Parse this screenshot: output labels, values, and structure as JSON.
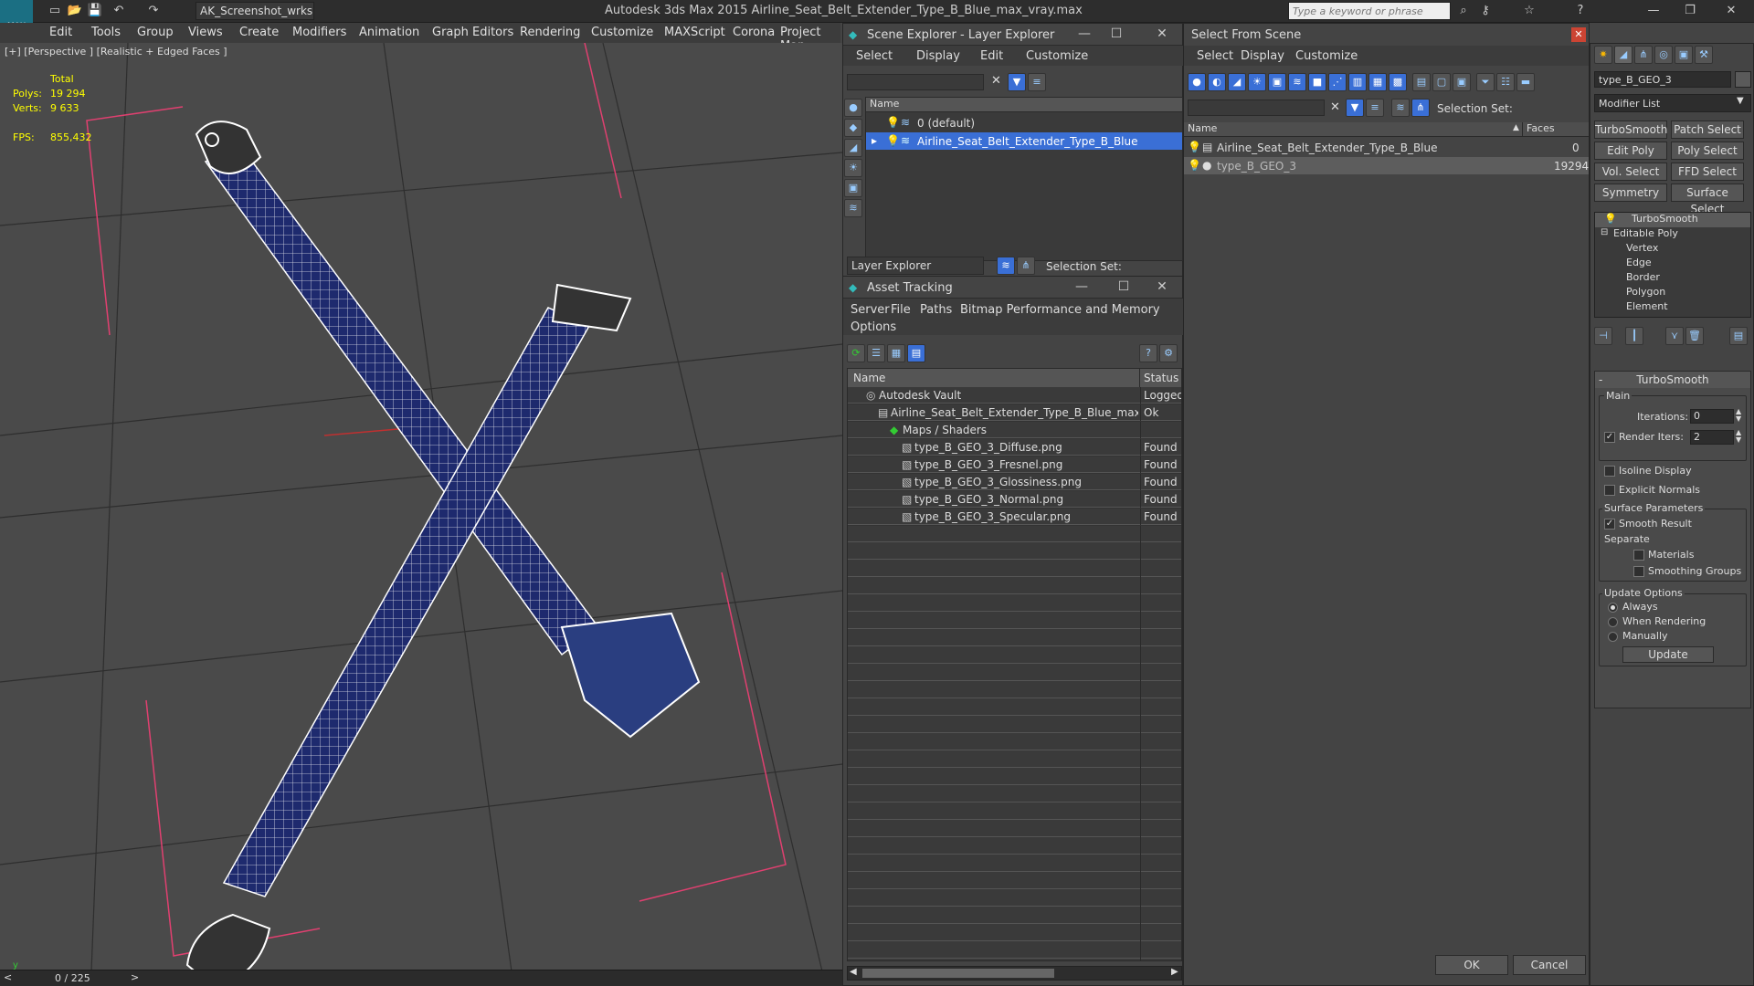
{
  "app": {
    "logo": "MAX",
    "title": "Autodesk 3ds Max  2015    Airline_Seat_Belt_Extender_Type_B_Blue_max_vray.max",
    "workspace": "AK_Screenshot_wrksp",
    "search_placeholder": "Type a keyword or phrase"
  },
  "menu": [
    "Edit",
    "Tools",
    "Group",
    "Views",
    "Create",
    "Modifiers",
    "Animation",
    "Graph Editors",
    "Rendering",
    "Customize",
    "MAXScript",
    "Corona",
    "Project Man"
  ],
  "viewport": {
    "label": "[+] [Perspective ] [Realistic + Edged Faces ]",
    "stats": {
      "total_label": "Total",
      "polys_label": "Polys:",
      "polys": "19 294",
      "verts_label": "Verts:",
      "verts": "9 633",
      "fps_label": "FPS:",
      "fps": "855,432"
    },
    "timeline": "0 / 225",
    "axis": {
      "x": "x",
      "y": "y",
      "z": "z"
    }
  },
  "scene_explorer": {
    "title": "Scene Explorer - Layer Explorer",
    "menu": [
      "Select",
      "Display",
      "Edit",
      "Customize"
    ],
    "column": "Name",
    "rows": [
      "0 (default)",
      "Airline_Seat_Belt_Extender_Type_B_Blue"
    ],
    "footer_dropdown": "Layer Explorer",
    "selection_set": "Selection Set:"
  },
  "asset_tracking": {
    "title": "Asset Tracking",
    "menu": [
      "Server",
      "File",
      "Paths",
      "Bitmap Performance and Memory"
    ],
    "menu2": "Options",
    "col_name": "Name",
    "col_status": "Status",
    "rows": [
      {
        "name": "Autodesk Vault",
        "status": "Logged",
        "indent": 0
      },
      {
        "name": "Airline_Seat_Belt_Extender_Type_B_Blue_max_vr...",
        "status": "Ok",
        "indent": 1
      },
      {
        "name": "Maps / Shaders",
        "status": "",
        "indent": 2
      },
      {
        "name": "type_B_GEO_3_Diffuse.png",
        "status": "Found",
        "indent": 3
      },
      {
        "name": "type_B_GEO_3_Fresnel.png",
        "status": "Found",
        "indent": 3
      },
      {
        "name": "type_B_GEO_3_Glossiness.png",
        "status": "Found",
        "indent": 3
      },
      {
        "name": "type_B_GEO_3_Normal.png",
        "status": "Found",
        "indent": 3
      },
      {
        "name": "type_B_GEO_3_Specular.png",
        "status": "Found",
        "indent": 3
      }
    ]
  },
  "select_from_scene": {
    "title": "Select From Scene",
    "menu": [
      "Select",
      "Display",
      "Customize"
    ],
    "selection_set": "Selection Set:",
    "col_name": "Name",
    "col_faces": "Faces",
    "rows": [
      {
        "name": "Airline_Seat_Belt_Extender_Type_B_Blue",
        "faces": "0"
      },
      {
        "name": "type_B_GEO_3",
        "faces": "19294"
      }
    ],
    "ok": "OK",
    "cancel": "Cancel"
  },
  "command_panel": {
    "object_name": "type_B_GEO_3",
    "modifier_list": "Modifier List",
    "buttons": [
      "TurboSmooth",
      "Patch Select",
      "Edit Poly",
      "Poly Select",
      "Vol. Select",
      "FFD Select",
      "Symmetry",
      "Surface Select"
    ],
    "stack": [
      "TurboSmooth",
      "Editable Poly",
      "Vertex",
      "Edge",
      "Border",
      "Polygon",
      "Element"
    ],
    "rollout_title": "TurboSmooth",
    "main_label": "Main",
    "iterations_label": "Iterations:",
    "iterations": "0",
    "render_iters_label": "Render Iters:",
    "render_iters": "2",
    "isoline": "Isoline Display",
    "explicit_normals": "Explicit Normals",
    "surface_params": "Surface Parameters",
    "smooth_result": "Smooth Result",
    "separate": "Separate",
    "materials": "Materials",
    "smoothing_groups": "Smoothing Groups",
    "update_options": "Update Options",
    "always": "Always",
    "when_rendering": "When Rendering",
    "manually": "Manually",
    "update": "Update"
  },
  "colors": {
    "selection": "#3a6fd6",
    "belt": "#1e2a6e",
    "wire": "#ffffff"
  }
}
